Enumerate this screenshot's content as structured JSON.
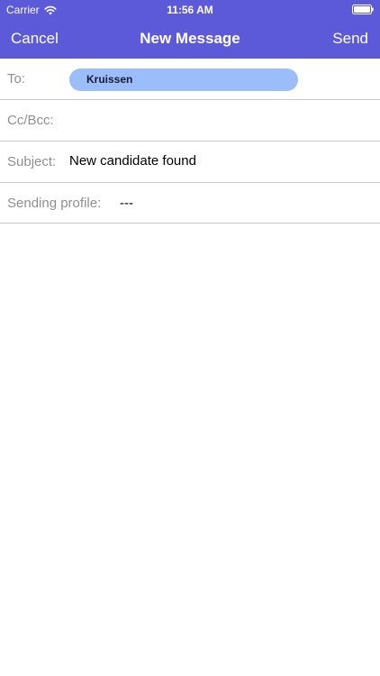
{
  "status_bar": {
    "carrier": "Carrier",
    "time": "11:56 AM",
    "wifi_icon": "wifi-icon",
    "battery_icon": "battery-icon"
  },
  "nav": {
    "cancel_label": "Cancel",
    "title": "New Message",
    "send_label": "Send",
    "bar_color": "#5d5ad9"
  },
  "form": {
    "to_label": "To:",
    "to_recipient": "Kruissen",
    "chip_color": "#9bbdfa",
    "cc_label": "Cc/Bcc:",
    "subject_label": "Subject:",
    "subject_value": "New candidate found",
    "profile_label": "Sending profile:",
    "profile_value": "---"
  }
}
